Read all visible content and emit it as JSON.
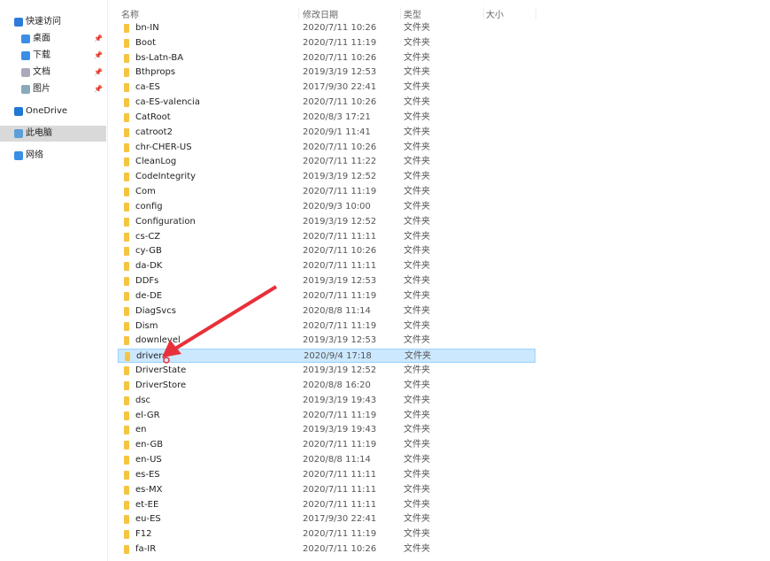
{
  "sidebar": {
    "items": [
      {
        "label": "快速访问",
        "icon": "star-icon",
        "pinned": false
      },
      {
        "label": "桌面",
        "icon": "desktop-folder-icon",
        "pinned": true
      },
      {
        "label": "下载",
        "icon": "download-folder-icon",
        "pinned": true
      },
      {
        "label": "文档",
        "icon": "documents-folder-icon",
        "pinned": true
      },
      {
        "label": "图片",
        "icon": "pictures-folder-icon",
        "pinned": true
      },
      {
        "label": "OneDrive",
        "icon": "cloud-icon",
        "pinned": false
      },
      {
        "label": "此电脑",
        "icon": "computer-icon",
        "pinned": false,
        "selected": true
      },
      {
        "label": "网络",
        "icon": "network-icon",
        "pinned": false
      }
    ]
  },
  "header": {
    "name": "名称",
    "date": "修改日期",
    "type": "类型",
    "size": "大小"
  },
  "files": [
    [
      "bn-IN",
      "2020/7/11 10:26"
    ],
    [
      "Boot",
      "2020/7/11 11:19"
    ],
    [
      "bs-Latn-BA",
      "2020/7/11 10:26"
    ],
    [
      "Bthprops",
      "2019/3/19 12:53"
    ],
    [
      "ca-ES",
      "2017/9/30 22:41"
    ],
    [
      "ca-ES-valencia",
      "2020/7/11 10:26"
    ],
    [
      "CatRoot",
      "2020/8/3 17:21"
    ],
    [
      "catroot2",
      "2020/9/1 11:41"
    ],
    [
      "chr-CHER-US",
      "2020/7/11 10:26"
    ],
    [
      "CleanLog",
      "2020/7/11 11:22"
    ],
    [
      "CodeIntegrity",
      "2019/3/19 12:52"
    ],
    [
      "Com",
      "2020/7/11 11:19"
    ],
    [
      "config",
      "2020/9/3 10:00"
    ],
    [
      "Configuration",
      "2019/3/19 12:52"
    ],
    [
      "cs-CZ",
      "2020/7/11 11:11"
    ],
    [
      "cy-GB",
      "2020/7/11 10:26"
    ],
    [
      "da-DK",
      "2020/7/11 11:11"
    ],
    [
      "DDFs",
      "2019/3/19 12:53"
    ],
    [
      "de-DE",
      "2020/7/11 11:19"
    ],
    [
      "DiagSvcs",
      "2020/8/8 11:14"
    ],
    [
      "Dism",
      "2020/7/11 11:19"
    ],
    [
      "downlevel",
      "2019/3/19 12:53"
    ],
    [
      "drivers",
      "2020/9/4 17:18"
    ],
    [
      "DriverState",
      "2019/3/19 12:52"
    ],
    [
      "DriverStore",
      "2020/8/8 16:20"
    ],
    [
      "dsc",
      "2019/3/19 19:43"
    ],
    [
      "el-GR",
      "2020/7/11 11:19"
    ],
    [
      "en",
      "2019/3/19 19:43"
    ],
    [
      "en-GB",
      "2020/7/11 11:19"
    ],
    [
      "en-US",
      "2020/8/8 11:14"
    ],
    [
      "es-ES",
      "2020/7/11 11:11"
    ],
    [
      "es-MX",
      "2020/7/11 11:11"
    ],
    [
      "et-EE",
      "2020/7/11 11:11"
    ],
    [
      "eu-ES",
      "2017/9/30 22:41"
    ],
    [
      "F12",
      "2020/7/11 11:19"
    ],
    [
      "fa-IR",
      "2020/7/11 10:26"
    ]
  ],
  "file_type": "文件夹",
  "selected_file": "drivers",
  "colors": {
    "selection": "#cce8ff",
    "folder": "#f5c542",
    "arrow": "#e8303a"
  }
}
